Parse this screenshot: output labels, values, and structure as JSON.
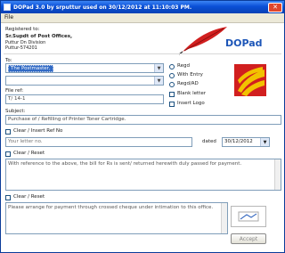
{
  "window": {
    "title": "DOPad 3.0 by srputtur used on 30/12/2012 at 11:10:03 PM."
  },
  "menu": {
    "file": "File"
  },
  "header": {
    "registered_to": "Registered to:",
    "org_line1": "Sr.Supdt of Post Offices,",
    "org_line2": "Puttur Dn Division",
    "org_line3": "Puttur-574201",
    "brand": "DOPad"
  },
  "form": {
    "to_label": "To:",
    "to_value": "The Postmaster,",
    "to_second_value": "",
    "file_ref_label": "File ref:",
    "file_ref_value": "T/ 14-1",
    "subject_label": "Subject:",
    "subject_value": "Purchase of / Refilling of Printer Toner Cartridge.",
    "clear_insert_ref": "Clear / Insert Ref No",
    "ref_placeholder": "Your letter no.",
    "dated_label": "dated",
    "dated_value": "30/12/2012",
    "clear_reset_1": "Clear / Reset",
    "body_text_1": "With reference to the above, the bill for Rs          is sent/ returned herewith duly passed for payment.",
    "clear_reset_2": "Clear / Reset",
    "body_text_2": "Please arrange for payment through crossed cheque under intimation to this office."
  },
  "options": {
    "regd": "Regd",
    "with_entry": "With Entry",
    "regd_ad": "Regd/AD",
    "blank_letter": "Blank letter",
    "insert_logo": "Insert Logo"
  },
  "accept": "Accept",
  "colors": {
    "titlebar": "#0a4fd6",
    "logo_red": "#d11f1f",
    "logo_yellow": "#f2c200",
    "brand_blue": "#1d56b8"
  }
}
